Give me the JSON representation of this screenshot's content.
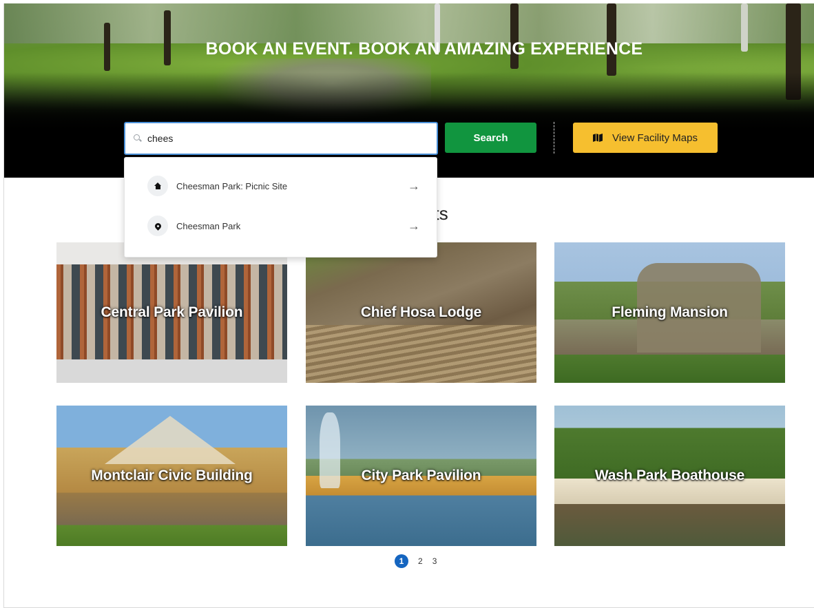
{
  "hero": {
    "title": "BOOK AN EVENT. BOOK AN AMAZING EXPERIENCE"
  },
  "search": {
    "value": "chees",
    "button_label": "Search",
    "maps_button_label": "View Facility Maps",
    "icons": {
      "search": "search-icon",
      "maps": "map-icon"
    },
    "colors": {
      "search_button": "#11953f",
      "maps_button": "#f6bf2f",
      "input_focus": "#4a90d9"
    }
  },
  "suggestions": [
    {
      "label": "Cheesman Park: Picnic Site",
      "icon": "home-icon",
      "arrow": "→"
    },
    {
      "label": "Cheesman Park",
      "icon": "location-pin-icon",
      "arrow": "→"
    }
  ],
  "section": {
    "title": "Events"
  },
  "venues": [
    {
      "name": "Central Park Pavilion"
    },
    {
      "name": "Chief Hosa Lodge"
    },
    {
      "name": "Fleming Mansion"
    },
    {
      "name": "Montclair Civic Building"
    },
    {
      "name": "City Park Pavilion"
    },
    {
      "name": "Wash Park Boathouse"
    }
  ],
  "pagination": {
    "current": "1",
    "pages": [
      "1",
      "2",
      "3"
    ],
    "active_color": "#1565c0"
  }
}
